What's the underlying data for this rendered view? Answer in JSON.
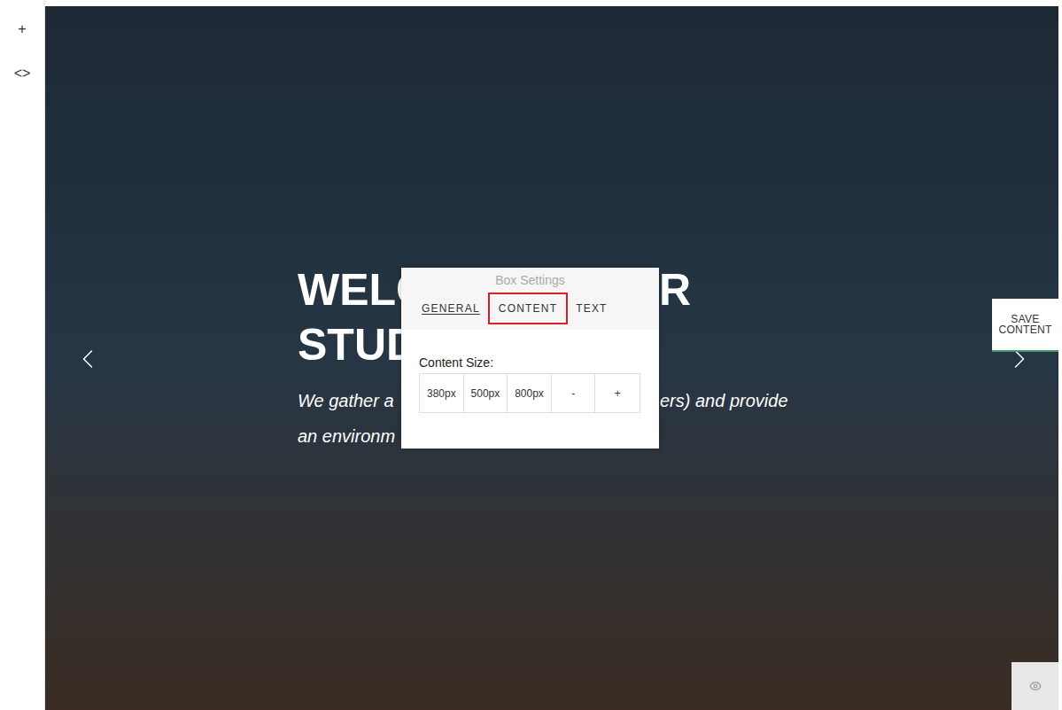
{
  "sidebar": {
    "buttons": [
      "+",
      "<>"
    ]
  },
  "hero": {
    "heading_lines": [
      [
        "WELC",
        "R"
      ],
      [
        "STUD"
      ]
    ],
    "subtitle_lines": [
      [
        "We gather a",
        "ers) and provide"
      ],
      [
        "an environm"
      ]
    ]
  },
  "save_button": "SAVE CONTENT",
  "dialog": {
    "title": "Box Settings",
    "tabs": [
      {
        "label": "GENERAL",
        "selected": false,
        "underlined": true
      },
      {
        "label": "CONTENT",
        "selected": true,
        "underlined": false
      },
      {
        "label": "TEXT",
        "selected": false,
        "underlined": false
      }
    ],
    "content_size_label": "Content Size:",
    "size_buttons": [
      "380px",
      "500px",
      "800px",
      "-",
      "+"
    ]
  }
}
